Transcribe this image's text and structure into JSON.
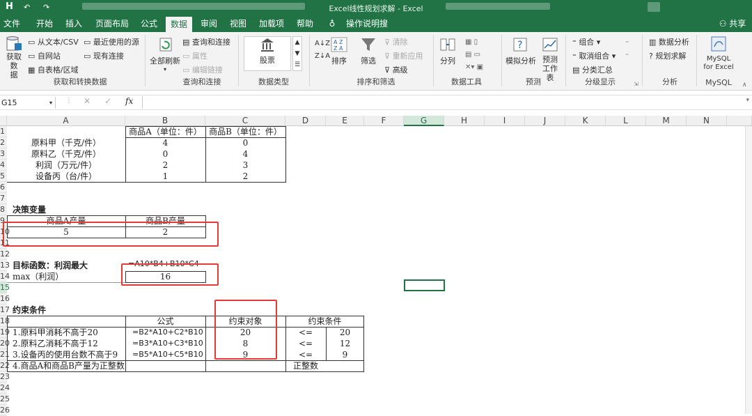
{
  "window": {
    "title": "Excel线性规划求解  -  Excel",
    "save_icon": "H"
  },
  "menu": {
    "tabs": [
      "文件",
      "开始",
      "插入",
      "页面布局",
      "公式",
      "数据",
      "审阅",
      "视图",
      "加载项",
      "帮助"
    ],
    "active": "数据",
    "tell_me": "操作说明搜索",
    "share": "共享"
  },
  "ribbon": {
    "get": {
      "big": "获取数\n据",
      "items": [
        "从文本/CSV",
        "自网站",
        "自表格/区域",
        "最近使用的源",
        "现有连接"
      ],
      "label": "获取和转换数据"
    },
    "query": {
      "refresh": "全部刷新",
      "items": [
        "查询和连接",
        "属性",
        "编辑链接"
      ],
      "label": "查询和连接"
    },
    "types": {
      "stock": "股票",
      "label": "数据类型"
    },
    "sort": {
      "sort": "排序",
      "filter": "筛选",
      "clear": "清除",
      "reapply": "重新应用",
      "advanced": "高级",
      "label": "排序和筛选"
    },
    "tools": {
      "split": "分列",
      "label": "数据工具"
    },
    "forecast": {
      "whatif": "模拟分析",
      "sheet": "预测\n工作表",
      "label": "预测"
    },
    "outline": {
      "items": [
        "组合",
        "取消组合",
        "分类汇总"
      ],
      "label": "分级显示"
    },
    "analysis": {
      "items": [
        "数据分析",
        "规划求解"
      ],
      "label": "分析"
    },
    "mysql": {
      "btn": "MySQL\nfor Excel",
      "label": "MySQL"
    }
  },
  "formula_bar": {
    "name_box": "G15",
    "fx": "fx",
    "value": ""
  },
  "columns": [
    "A",
    "B",
    "C",
    "D",
    "E",
    "F",
    "G",
    "H",
    "I",
    "J",
    "K",
    "L",
    "M",
    "N"
  ],
  "rows": [
    "1",
    "2",
    "3",
    "4",
    "5",
    "6",
    "7",
    "8",
    "9",
    "10",
    "11",
    "12",
    "13",
    "14",
    "15",
    "16",
    "17",
    "18",
    "19",
    "20",
    "21",
    "22",
    "23",
    "24",
    "25",
    "26"
  ],
  "sheet": {
    "t1": {
      "headers": [
        "",
        "商品A（单位：件）",
        "商品B（单位：件）"
      ],
      "rows": [
        [
          "原料甲（千克/件）",
          "4",
          "0"
        ],
        [
          "原料乙（千克/件）",
          "0",
          "4"
        ],
        [
          "利润（万元/件）",
          "2",
          "3"
        ],
        [
          "设备丙（台/件）",
          "1",
          "2"
        ]
      ]
    },
    "decision": {
      "title": "决策变量",
      "headers": [
        "商品A产量",
        "商品B产量"
      ],
      "values": [
        "5",
        "2"
      ]
    },
    "objective": {
      "title": "目标函数：利润最大",
      "formula": "=A10*B4+B10*C4",
      "label": "max（利润）",
      "value": "16"
    },
    "constraints": {
      "title": "约束条件",
      "headers": [
        "",
        "公式",
        "约束对象",
        "约束条件"
      ],
      "rows": [
        [
          "1.原料甲消耗不高于20",
          "=B2*A10+C2*B10",
          "20",
          "<=",
          "20"
        ],
        [
          "2.原料乙消耗不高于12",
          "=B3*A10+C3*B10",
          "8",
          "<=",
          "12"
        ],
        [
          "3.设备丙的使用台数不高于9",
          "=B5*A10+C5*B10",
          "9",
          "<=",
          "9"
        ],
        [
          "4.商品A和商品B产量为正整数",
          "",
          "",
          "正整数",
          ""
        ]
      ]
    }
  },
  "colors": {
    "excel_green": "#217346",
    "highlight": "#e53935",
    "selection": "#217346"
  }
}
